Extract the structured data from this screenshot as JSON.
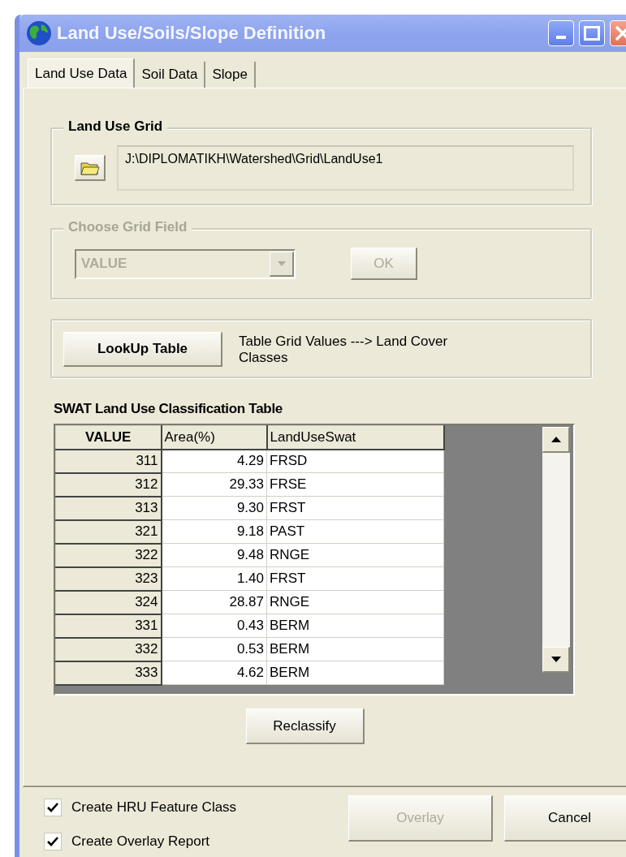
{
  "window": {
    "title": "Land Use/Soils/Slope Definition"
  },
  "tabs": [
    {
      "label": "Land Use Data",
      "selected": true
    },
    {
      "label": "Soil Data",
      "selected": false
    },
    {
      "label": "Slope",
      "selected": false
    }
  ],
  "land_use_grid": {
    "title": "Land Use Grid",
    "path": "J:\\DIPLOMATIKH\\Watershed\\Grid\\LandUse1"
  },
  "choose_grid_field": {
    "title": "Choose Grid Field",
    "disabled": true,
    "field": "VALUE",
    "ok_button": "OK"
  },
  "lookup": {
    "button": "LookUp Table",
    "description": "Table Grid Values ---> Land Cover Classes"
  },
  "table": {
    "title": "SWAT Land Use Classification Table",
    "columns": [
      "VALUE",
      "Area(%)",
      "LandUseSwat"
    ],
    "rows": [
      [
        "311",
        "4.29",
        "FRSD"
      ],
      [
        "312",
        "29.33",
        "FRSE"
      ],
      [
        "313",
        "9.30",
        "FRST"
      ],
      [
        "321",
        "9.18",
        "PAST"
      ],
      [
        "322",
        "9.48",
        "RNGE"
      ],
      [
        "323",
        "1.40",
        "FRST"
      ],
      [
        "324",
        "28.87",
        "RNGE"
      ],
      [
        "331",
        "0.43",
        "BERM"
      ],
      [
        "332",
        "0.53",
        "BERM"
      ],
      [
        "333",
        "4.62",
        "BERM"
      ]
    ]
  },
  "reclassify_button": "Reclassify",
  "options": [
    {
      "label": "Create HRU Feature Class",
      "checked": true
    },
    {
      "label": "Create Overlay Report",
      "checked": true
    }
  ],
  "buttons": [
    {
      "label": "Overlay",
      "disabled": true
    },
    {
      "label": "Cancel",
      "disabled": false
    }
  ]
}
